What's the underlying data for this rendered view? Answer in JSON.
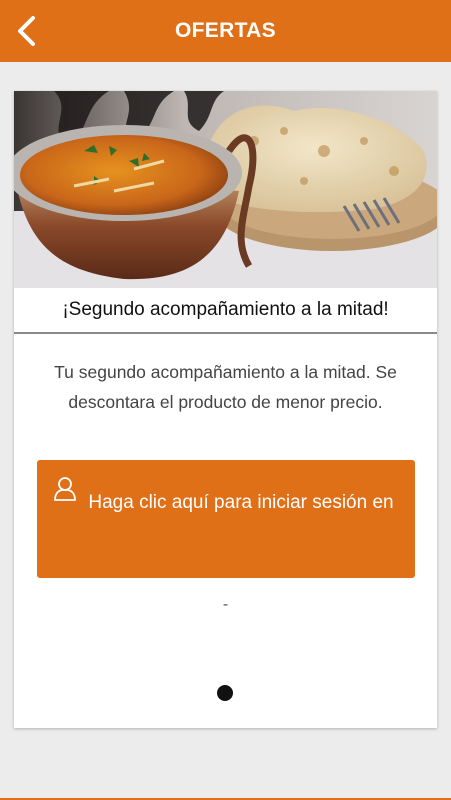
{
  "header": {
    "title": "OFERTAS",
    "back_icon": "chevron-left-icon",
    "color": "#e07018"
  },
  "offer": {
    "image_icon": "food-photo",
    "title": "¡Segundo acompañamiento a la mitad!",
    "description": "Tu segundo acompañamiento a la mitad. Se descontara el producto de menor precio.",
    "login_button": {
      "icon": "user-icon",
      "label": "Haga clic aquí para iniciar sesión en"
    },
    "separator_text": "-",
    "pager": {
      "current": 1,
      "total": 1
    }
  }
}
